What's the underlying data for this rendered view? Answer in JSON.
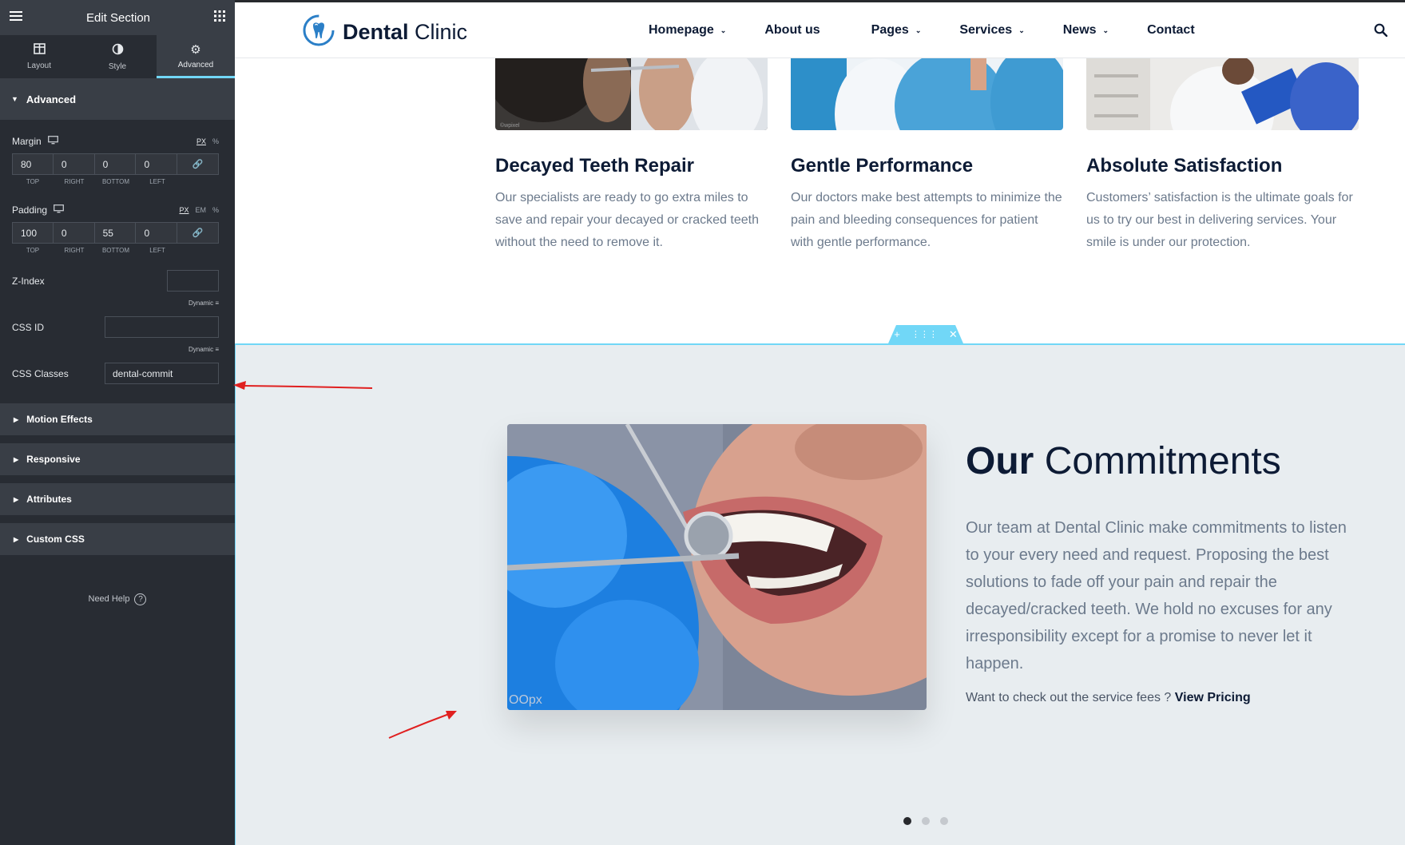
{
  "editor": {
    "title": "Edit Section",
    "tabs": [
      {
        "label": "Layout",
        "icon": "layout-icon"
      },
      {
        "label": "Style",
        "icon": "contrast-icon"
      },
      {
        "label": "Advanced",
        "icon": "gear-icon"
      }
    ],
    "section_title": "Advanced",
    "margin": {
      "label": "Margin",
      "units": [
        "PX",
        "%"
      ],
      "top": "80",
      "right": "0",
      "bottom": "0",
      "left": "0"
    },
    "padding": {
      "label": "Padding",
      "units": [
        "PX",
        "EM",
        "%"
      ],
      "top": "100",
      "right": "0",
      "bottom": "55",
      "left": "0"
    },
    "dim_labels": [
      "TOP",
      "RIGHT",
      "BOTTOM",
      "LEFT"
    ],
    "z_index_label": "Z-Index",
    "css_id_label": "CSS ID",
    "css_classes_label": "CSS Classes",
    "css_classes_value": "dental-commit",
    "dynamic_label": "Dynamic",
    "collapsed_sections": [
      "Motion Effects",
      "Responsive",
      "Attributes",
      "Custom CSS"
    ],
    "need_help": "Need Help"
  },
  "site": {
    "logo_bold": "Dental",
    "logo_light": "Clinic",
    "nav": [
      {
        "label": "Homepage",
        "dropdown": true
      },
      {
        "label": "About us",
        "dropdown": false
      },
      {
        "label": "Pages",
        "dropdown": true
      },
      {
        "label": "Services",
        "dropdown": true
      },
      {
        "label": "News",
        "dropdown": true
      },
      {
        "label": "Contact",
        "dropdown": false
      }
    ],
    "cards": [
      {
        "title": "Decayed Teeth Repair",
        "text": "Our specialists are ready to go extra miles to save and repair your decayed or cracked teeth without the need to remove it."
      },
      {
        "title": "Gentle Performance",
        "text": "Our doctors make best attempts to minimize the pain and bleeding consequences for patient with gentle performance."
      },
      {
        "title": "Absolute Satisfaction",
        "text": "Customers’ satisfaction is the ultimate goals for us to try our best in delivering services. Your smile is under our protection."
      }
    ],
    "commit_title_bold": "Our",
    "commit_title_light": "Commitments",
    "commit_text": "Our team at Dental Clinic make commitments to listen to your every need and request. Proposing the best solutions to fade off your pain and repair the decayed/cracked teeth. We hold no excuses for any irresponsibility except for a promise to never let it happen.",
    "cta_text": "Want to check out the service fees ?",
    "cta_link": "View Pricing",
    "slider_dots": 3,
    "active_dot": 1
  },
  "colors": {
    "panel_bg": "#282c33",
    "panel_header": "#393e46",
    "accent": "#71d7f7",
    "brand_dark": "#0d1b35",
    "annotation_arrow": "#e02020"
  }
}
